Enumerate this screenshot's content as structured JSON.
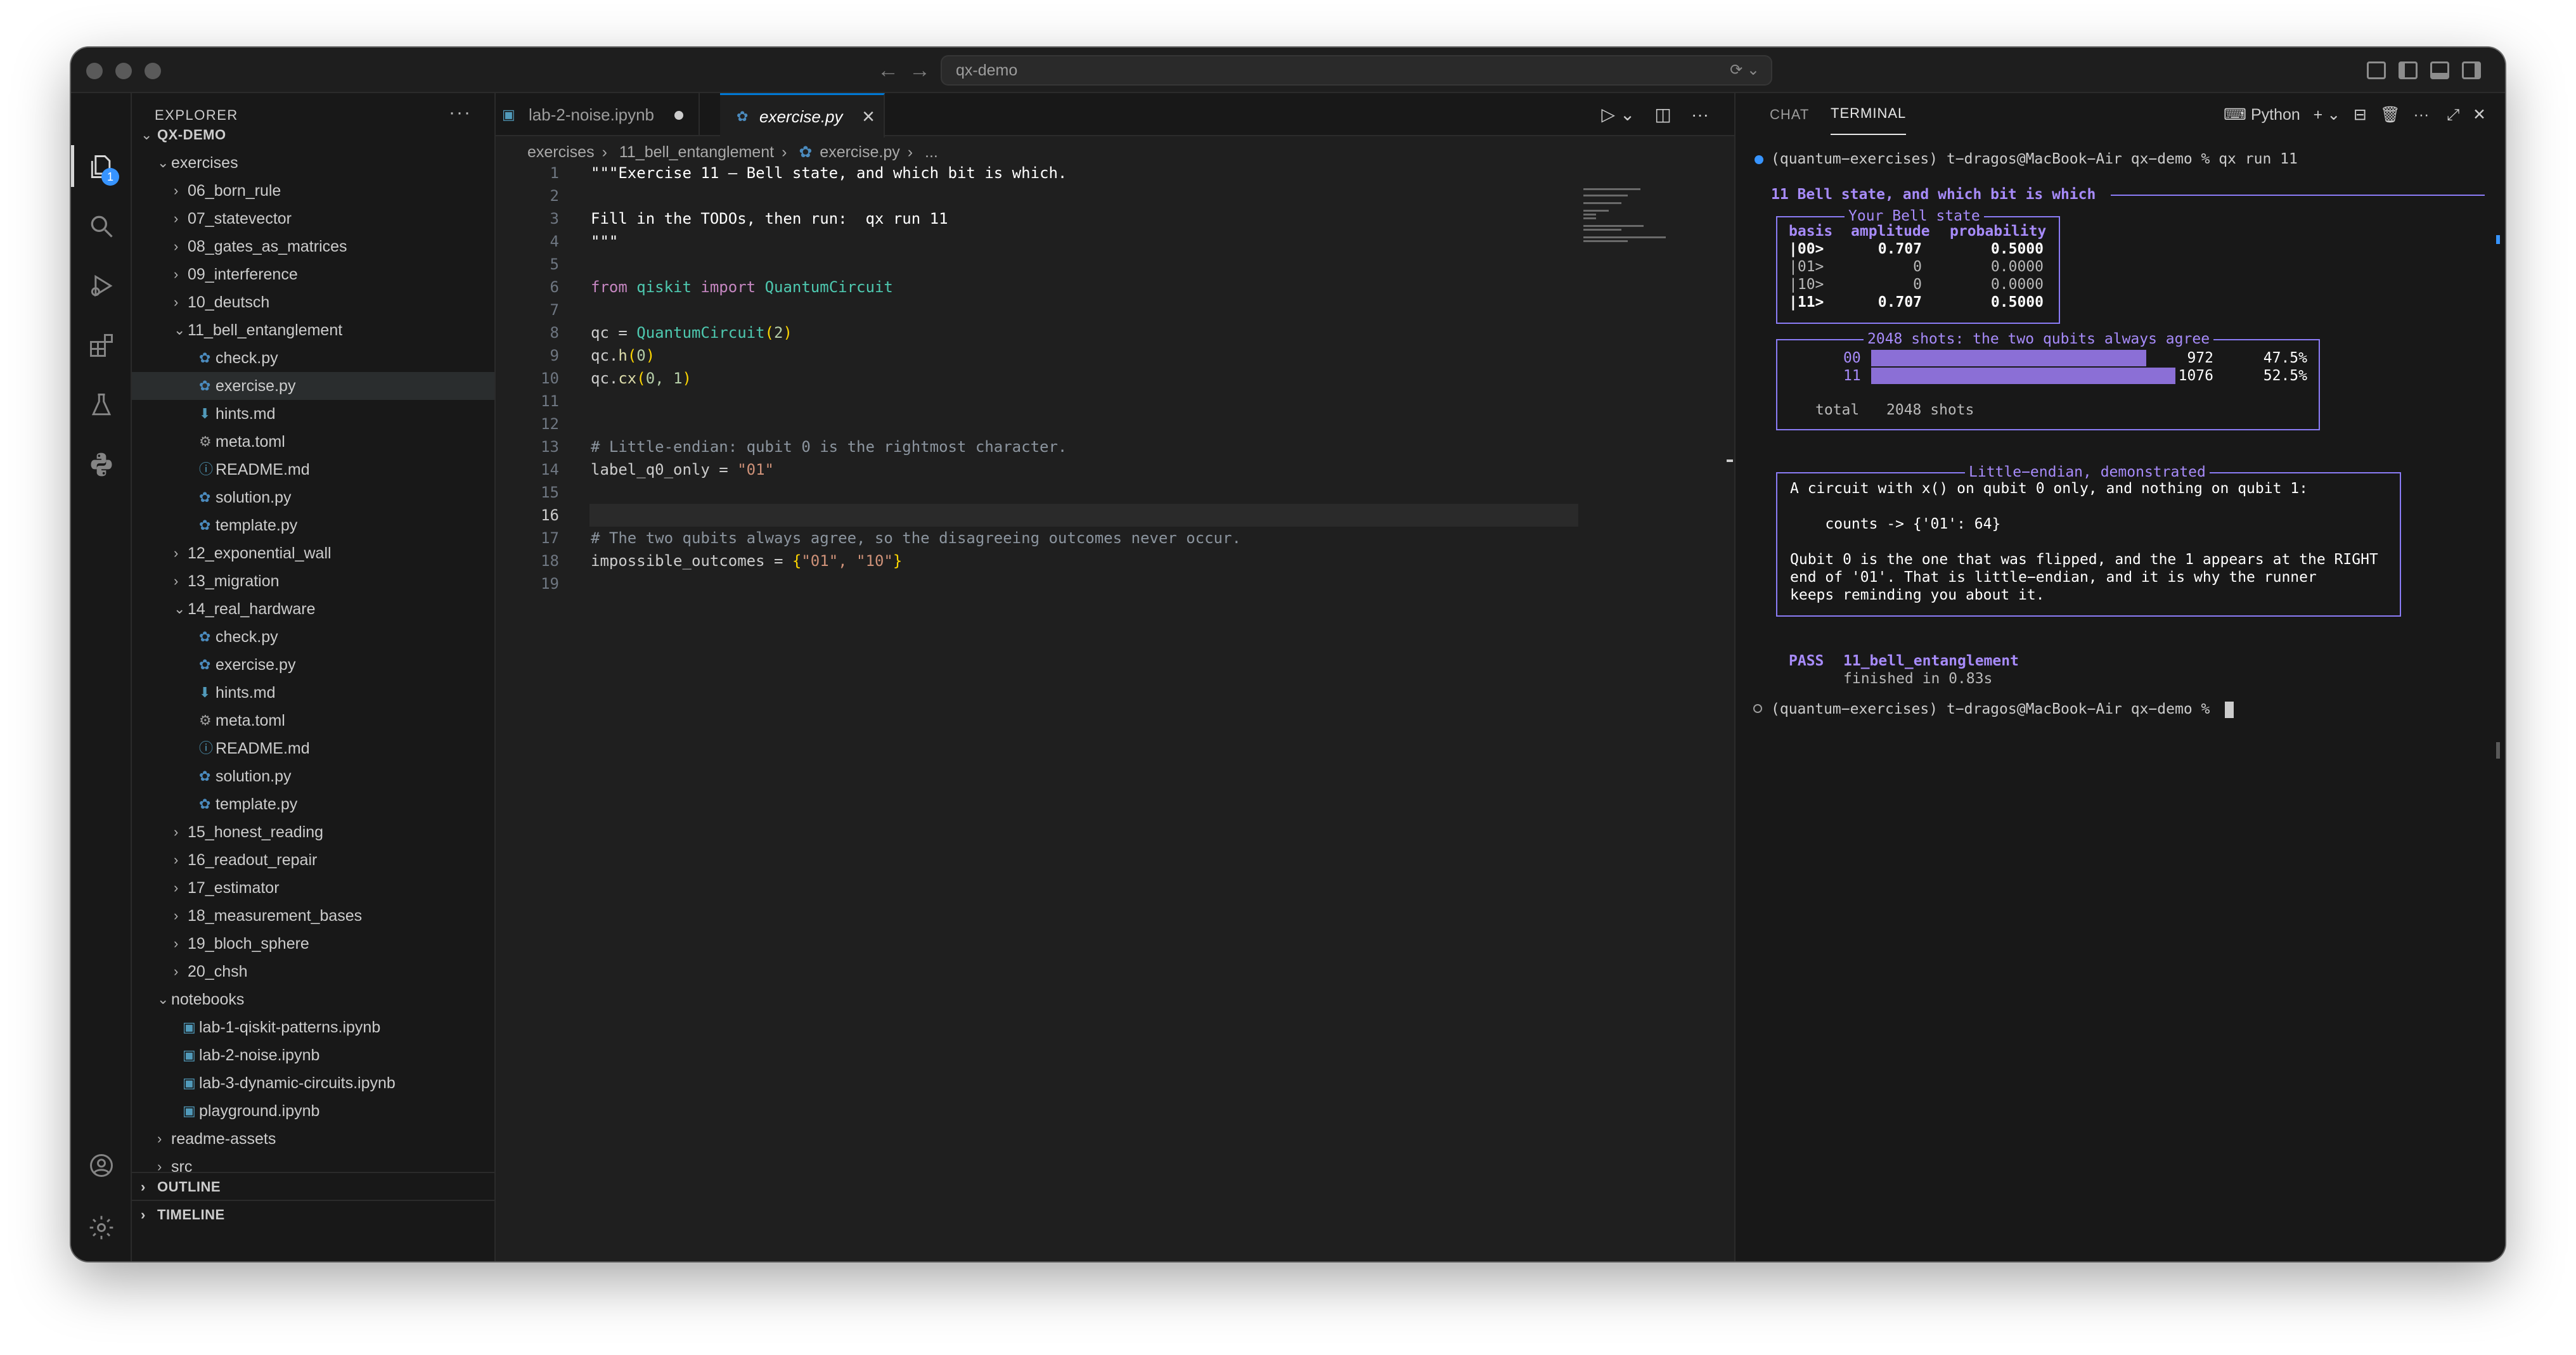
{
  "titlebar": {
    "back_icon": "arrow-left-icon",
    "forward_icon": "arrow-right-icon",
    "command_center_text": "qx-demo"
  },
  "activity_bar": {
    "items": [
      "explorer-icon",
      "search-icon",
      "run-debug-icon",
      "extensions-icon",
      "testing-icon",
      "python-icon"
    ],
    "explorer_badge": "1",
    "bottom": [
      "account-icon",
      "settings-gear-icon"
    ]
  },
  "explorer": {
    "header": "EXPLORER",
    "more": "···",
    "root": "QX-DEMO",
    "tree": [
      {
        "label": "exercises",
        "depth": 0,
        "type": "folder",
        "open": true
      },
      {
        "label": "06_born_rule",
        "depth": 1,
        "type": "folder"
      },
      {
        "label": "07_statevector",
        "depth": 1,
        "type": "folder"
      },
      {
        "label": "08_gates_as_matrices",
        "depth": 1,
        "type": "folder"
      },
      {
        "label": "09_interference",
        "depth": 1,
        "type": "folder"
      },
      {
        "label": "10_deutsch",
        "depth": 1,
        "type": "folder"
      },
      {
        "label": "11_bell_entanglement",
        "depth": 1,
        "type": "folder",
        "open": true
      },
      {
        "label": "check.py",
        "depth": 2,
        "type": "py"
      },
      {
        "label": "exercise.py",
        "depth": 2,
        "type": "py",
        "selected": true
      },
      {
        "label": "hints.md",
        "depth": 2,
        "type": "md"
      },
      {
        "label": "meta.toml",
        "depth": 2,
        "type": "toml"
      },
      {
        "label": "README.md",
        "depth": 2,
        "type": "info"
      },
      {
        "label": "solution.py",
        "depth": 2,
        "type": "py"
      },
      {
        "label": "template.py",
        "depth": 2,
        "type": "py"
      },
      {
        "label": "12_exponential_wall",
        "depth": 1,
        "type": "folder"
      },
      {
        "label": "13_migration",
        "depth": 1,
        "type": "folder"
      },
      {
        "label": "14_real_hardware",
        "depth": 1,
        "type": "folder",
        "open": true
      },
      {
        "label": "check.py",
        "depth": 2,
        "type": "py"
      },
      {
        "label": "exercise.py",
        "depth": 2,
        "type": "py"
      },
      {
        "label": "hints.md",
        "depth": 2,
        "type": "md"
      },
      {
        "label": "meta.toml",
        "depth": 2,
        "type": "toml"
      },
      {
        "label": "README.md",
        "depth": 2,
        "type": "info"
      },
      {
        "label": "solution.py",
        "depth": 2,
        "type": "py"
      },
      {
        "label": "template.py",
        "depth": 2,
        "type": "py"
      },
      {
        "label": "15_honest_reading",
        "depth": 1,
        "type": "folder"
      },
      {
        "label": "16_readout_repair",
        "depth": 1,
        "type": "folder"
      },
      {
        "label": "17_estimator",
        "depth": 1,
        "type": "folder"
      },
      {
        "label": "18_measurement_bases",
        "depth": 1,
        "type": "folder"
      },
      {
        "label": "19_bloch_sphere",
        "depth": 1,
        "type": "folder"
      },
      {
        "label": "20_chsh",
        "depth": 1,
        "type": "folder"
      },
      {
        "label": "notebooks",
        "depth": 0,
        "type": "folder",
        "open": true
      },
      {
        "label": "lab-1-qiskit-patterns.ipynb",
        "depth": 1,
        "type": "nb"
      },
      {
        "label": "lab-2-noise.ipynb",
        "depth": 1,
        "type": "nb"
      },
      {
        "label": "lab-3-dynamic-circuits.ipynb",
        "depth": 1,
        "type": "nb"
      },
      {
        "label": "playground.ipynb",
        "depth": 1,
        "type": "nb"
      },
      {
        "label": "readme-assets",
        "depth": 0,
        "type": "folder"
      },
      {
        "label": "src",
        "depth": 0,
        "type": "folder"
      }
    ],
    "outline": "OUTLINE",
    "timeline": "TIMELINE"
  },
  "editor": {
    "tabs": [
      {
        "label": "lab-2-noise.ipynb",
        "dirty": true
      },
      {
        "label": "exercise.py",
        "active": true
      }
    ],
    "breadcrumb": [
      "exercises",
      "11_bell_entanglement",
      "exercise.py",
      "..."
    ],
    "current_line": 16,
    "lines": [
      "\"\"\"Exercise 11 — Bell state, and which bit is which.",
      "",
      "Fill in the TODOs, then run:  qx run 11",
      "\"\"\"",
      "",
      "from qiskit import QuantumCircuit",
      "",
      "qc = QuantumCircuit(2)",
      "qc.h(0)",
      "qc.cx(0, 1)",
      "",
      "",
      "# Little-endian: qubit 0 is the rightmost character.",
      "label_q0_only = \"01\"",
      "",
      "",
      "# The two qubits always agree, so the disagreeing outcomes never occur.",
      "impossible_outcomes = {\"01\", \"10\"}",
      ""
    ]
  },
  "panel": {
    "tabs": [
      "CHAT",
      "TERMINAL"
    ],
    "active_tab": "TERMINAL",
    "profile": "Python",
    "terminal": {
      "prompt1": "(quantum−exercises) t−dragos@MacBook−Air qx−demo % qx run 11",
      "heading": "11 Bell state, and which bit is which",
      "state_box_title": "Your Bell state",
      "state_headers": [
        "basis",
        "amplitude",
        "probability"
      ],
      "state_rows": [
        {
          "basis": "|00>",
          "amplitude": "0.707",
          "probability": "0.5000"
        },
        {
          "basis": "|01>",
          "amplitude": "0",
          "probability": "0.0000"
        },
        {
          "basis": "|10>",
          "amplitude": "0",
          "probability": "0.0000"
        },
        {
          "basis": "|11>",
          "amplitude": "0.707",
          "probability": "0.5000"
        }
      ],
      "shots_box_title": "2048 shots: the two qubits always agree",
      "shots": [
        {
          "label": "00",
          "count": "972",
          "pct": "47.5%",
          "fraction": 0.475
        },
        {
          "label": "11",
          "count": "1076",
          "pct": "52.5%",
          "fraction": 0.525
        }
      ],
      "shots_total_label": "total",
      "shots_total_value": "2048 shots",
      "endian_box_title": "Little−endian, demonstrated",
      "endian_lines": [
        "A circuit with x() on qubit 0 only, and nothing on qubit 1:",
        "",
        "    counts -> {'01': 64}",
        "",
        "Qubit 0 is the one that was flipped, and the 1 appears at the RIGHT",
        "end of '01'. That is little−endian, and it is why the runner",
        "keeps reminding you about it."
      ],
      "pass_label": "PASS",
      "pass_name": "11_bell_entanglement",
      "finished": "finished in 0.83s",
      "prompt2": "(quantum−exercises) t−dragos@MacBook−Air qx−demo %"
    }
  },
  "colors": {
    "accent": "#0078d4",
    "terminal_purple": "#a78bfa",
    "bar": "#8b6fd6"
  }
}
